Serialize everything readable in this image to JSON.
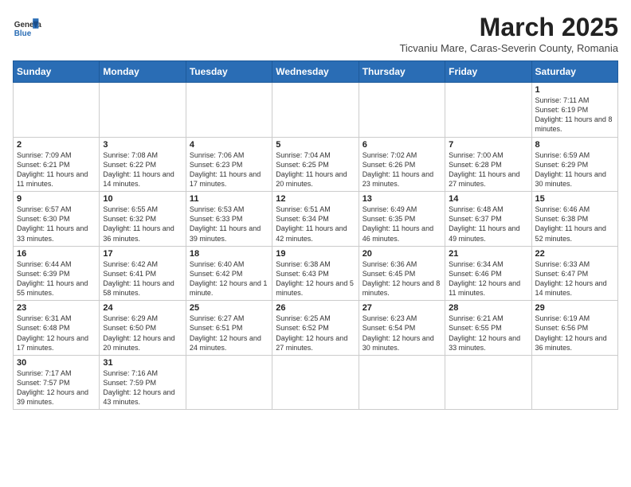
{
  "header": {
    "logo_line1": "General",
    "logo_line2": "Blue",
    "month_title": "March 2025",
    "subtitle": "Ticvaniu Mare, Caras-Severin County, Romania"
  },
  "weekdays": [
    "Sunday",
    "Monday",
    "Tuesday",
    "Wednesday",
    "Thursday",
    "Friday",
    "Saturday"
  ],
  "weeks": [
    [
      {
        "day": "",
        "info": ""
      },
      {
        "day": "",
        "info": ""
      },
      {
        "day": "",
        "info": ""
      },
      {
        "day": "",
        "info": ""
      },
      {
        "day": "",
        "info": ""
      },
      {
        "day": "",
        "info": ""
      },
      {
        "day": "1",
        "info": "Sunrise: 7:11 AM\nSunset: 6:19 PM\nDaylight: 11 hours and 8 minutes."
      }
    ],
    [
      {
        "day": "2",
        "info": "Sunrise: 7:09 AM\nSunset: 6:21 PM\nDaylight: 11 hours and 11 minutes."
      },
      {
        "day": "3",
        "info": "Sunrise: 7:08 AM\nSunset: 6:22 PM\nDaylight: 11 hours and 14 minutes."
      },
      {
        "day": "4",
        "info": "Sunrise: 7:06 AM\nSunset: 6:23 PM\nDaylight: 11 hours and 17 minutes."
      },
      {
        "day": "5",
        "info": "Sunrise: 7:04 AM\nSunset: 6:25 PM\nDaylight: 11 hours and 20 minutes."
      },
      {
        "day": "6",
        "info": "Sunrise: 7:02 AM\nSunset: 6:26 PM\nDaylight: 11 hours and 23 minutes."
      },
      {
        "day": "7",
        "info": "Sunrise: 7:00 AM\nSunset: 6:28 PM\nDaylight: 11 hours and 27 minutes."
      },
      {
        "day": "8",
        "info": "Sunrise: 6:59 AM\nSunset: 6:29 PM\nDaylight: 11 hours and 30 minutes."
      }
    ],
    [
      {
        "day": "9",
        "info": "Sunrise: 6:57 AM\nSunset: 6:30 PM\nDaylight: 11 hours and 33 minutes."
      },
      {
        "day": "10",
        "info": "Sunrise: 6:55 AM\nSunset: 6:32 PM\nDaylight: 11 hours and 36 minutes."
      },
      {
        "day": "11",
        "info": "Sunrise: 6:53 AM\nSunset: 6:33 PM\nDaylight: 11 hours and 39 minutes."
      },
      {
        "day": "12",
        "info": "Sunrise: 6:51 AM\nSunset: 6:34 PM\nDaylight: 11 hours and 42 minutes."
      },
      {
        "day": "13",
        "info": "Sunrise: 6:49 AM\nSunset: 6:35 PM\nDaylight: 11 hours and 46 minutes."
      },
      {
        "day": "14",
        "info": "Sunrise: 6:48 AM\nSunset: 6:37 PM\nDaylight: 11 hours and 49 minutes."
      },
      {
        "day": "15",
        "info": "Sunrise: 6:46 AM\nSunset: 6:38 PM\nDaylight: 11 hours and 52 minutes."
      }
    ],
    [
      {
        "day": "16",
        "info": "Sunrise: 6:44 AM\nSunset: 6:39 PM\nDaylight: 11 hours and 55 minutes."
      },
      {
        "day": "17",
        "info": "Sunrise: 6:42 AM\nSunset: 6:41 PM\nDaylight: 11 hours and 58 minutes."
      },
      {
        "day": "18",
        "info": "Sunrise: 6:40 AM\nSunset: 6:42 PM\nDaylight: 12 hours and 1 minute."
      },
      {
        "day": "19",
        "info": "Sunrise: 6:38 AM\nSunset: 6:43 PM\nDaylight: 12 hours and 5 minutes."
      },
      {
        "day": "20",
        "info": "Sunrise: 6:36 AM\nSunset: 6:45 PM\nDaylight: 12 hours and 8 minutes."
      },
      {
        "day": "21",
        "info": "Sunrise: 6:34 AM\nSunset: 6:46 PM\nDaylight: 12 hours and 11 minutes."
      },
      {
        "day": "22",
        "info": "Sunrise: 6:33 AM\nSunset: 6:47 PM\nDaylight: 12 hours and 14 minutes."
      }
    ],
    [
      {
        "day": "23",
        "info": "Sunrise: 6:31 AM\nSunset: 6:48 PM\nDaylight: 12 hours and 17 minutes."
      },
      {
        "day": "24",
        "info": "Sunrise: 6:29 AM\nSunset: 6:50 PM\nDaylight: 12 hours and 20 minutes."
      },
      {
        "day": "25",
        "info": "Sunrise: 6:27 AM\nSunset: 6:51 PM\nDaylight: 12 hours and 24 minutes."
      },
      {
        "day": "26",
        "info": "Sunrise: 6:25 AM\nSunset: 6:52 PM\nDaylight: 12 hours and 27 minutes."
      },
      {
        "day": "27",
        "info": "Sunrise: 6:23 AM\nSunset: 6:54 PM\nDaylight: 12 hours and 30 minutes."
      },
      {
        "day": "28",
        "info": "Sunrise: 6:21 AM\nSunset: 6:55 PM\nDaylight: 12 hours and 33 minutes."
      },
      {
        "day": "29",
        "info": "Sunrise: 6:19 AM\nSunset: 6:56 PM\nDaylight: 12 hours and 36 minutes."
      }
    ],
    [
      {
        "day": "30",
        "info": "Sunrise: 7:17 AM\nSunset: 7:57 PM\nDaylight: 12 hours and 39 minutes."
      },
      {
        "day": "31",
        "info": "Sunrise: 7:16 AM\nSunset: 7:59 PM\nDaylight: 12 hours and 43 minutes."
      },
      {
        "day": "",
        "info": ""
      },
      {
        "day": "",
        "info": ""
      },
      {
        "day": "",
        "info": ""
      },
      {
        "day": "",
        "info": ""
      },
      {
        "day": "",
        "info": ""
      }
    ]
  ]
}
